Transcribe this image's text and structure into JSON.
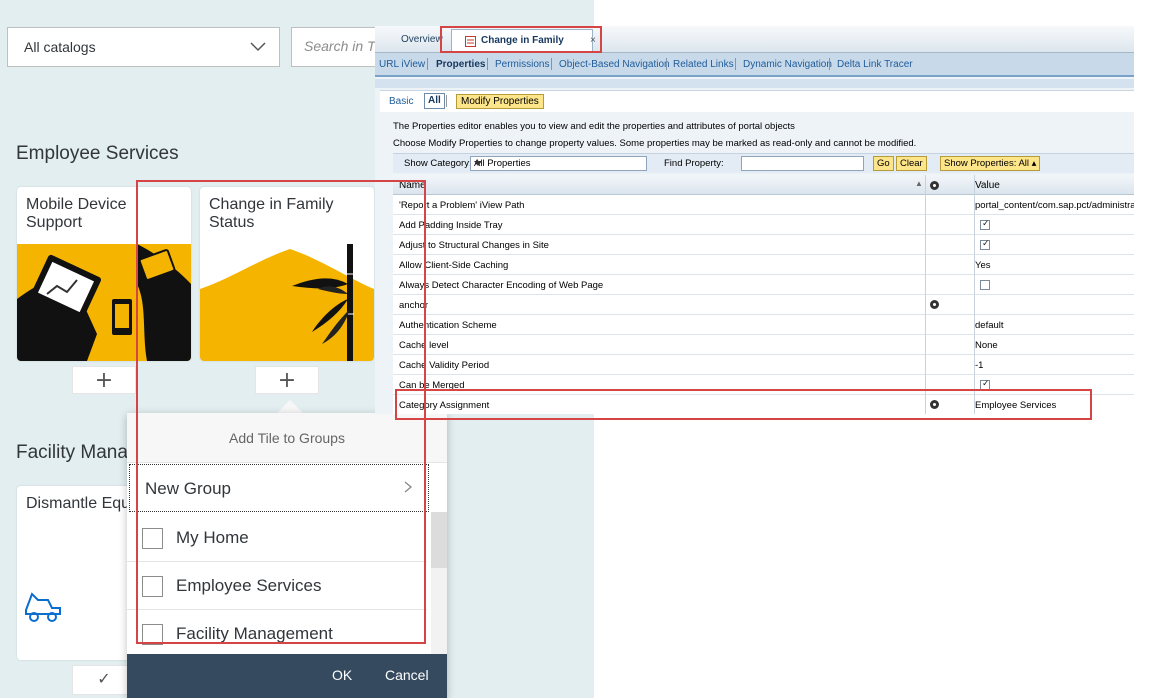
{
  "catalog": {
    "select_value": "All catalogs",
    "search_placeholder": "Search in Tiles"
  },
  "groups": [
    {
      "title": "Employee Services",
      "tiles": [
        {
          "title": "Mobile Device Support",
          "action": "+"
        },
        {
          "title": "Change in Family Status",
          "action": "+"
        }
      ]
    },
    {
      "title": "Facility Management",
      "tiles": [
        {
          "title": "Dismantle Equipment",
          "action": "✓"
        }
      ]
    }
  ],
  "popover": {
    "title": "Add Tile to Groups",
    "new_group_label": "New Group",
    "items": [
      "My Home",
      "Employee Services",
      "Facility Management"
    ],
    "ok_label": "OK",
    "cancel_label": "Cancel"
  },
  "portal": {
    "tabs": [
      "Overview",
      "Change in Family Status"
    ],
    "tab_close": "×",
    "nav_links": [
      "URL iView",
      "Properties",
      "Permissions",
      "Object-Based Navigation",
      "Related Links",
      "Dynamic Navigation",
      "Delta Link Tracer"
    ],
    "active_nav": "Properties",
    "sub_tabs": {
      "basic": "Basic",
      "all": "All",
      "modify": "Modify Properties"
    },
    "info_lines": [
      "The Properties editor enables you to view and edit the properties and attributes of portal objects",
      "Choose Modify Properties to change property values. Some properties may be marked as read-only and cannot be modified."
    ],
    "filter": {
      "show_category_label": "Show Category:",
      "show_category_value": "All Properties",
      "find_property_label": "Find Property:",
      "go_label": "Go",
      "clear_label": "Clear",
      "show_properties_label": "Show Properties: All ▴"
    },
    "columns": {
      "name": "Name",
      "sort": "▲",
      "value": "Value"
    },
    "rows": [
      {
        "name": "'Report a Problem' iView Path",
        "value": "portal_content/com.sap.pct/administrato",
        "type": "text"
      },
      {
        "name": "Add Padding Inside Tray",
        "value": "",
        "type": "checked"
      },
      {
        "name": "Adjust to Structural Changes in Site",
        "value": "",
        "type": "checked"
      },
      {
        "name": "Allow Client-Side Caching",
        "value": "Yes",
        "type": "text"
      },
      {
        "name": "Always Detect Character Encoding of Web Page",
        "value": "",
        "type": "unchecked"
      },
      {
        "name": "anchor",
        "value": "",
        "type": "text",
        "icon": true
      },
      {
        "name": "Authentication Scheme",
        "value": "default",
        "type": "text"
      },
      {
        "name": "Cache level",
        "value": "None",
        "type": "text"
      },
      {
        "name": "Cache Validity Period",
        "value": "-1",
        "type": "text"
      },
      {
        "name": "Can be Merged",
        "value": "",
        "type": "checked"
      },
      {
        "name": "Category Assignment",
        "value": "Employee Services",
        "type": "text",
        "icon": true
      }
    ]
  },
  "colors": {
    "fiori_bg": "#e2eef0",
    "sap_gold": "#f5b400",
    "footer": "#354a5f",
    "highlight": "#d64545",
    "portal_nav": "#c8d9ea"
  }
}
